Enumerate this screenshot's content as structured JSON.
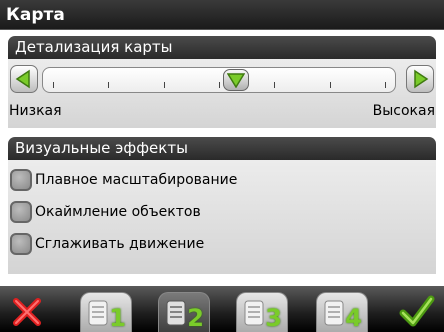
{
  "window": {
    "title": "Карта"
  },
  "detail": {
    "header": "Детализация карты",
    "low_label": "Низкая",
    "high_label": "Высокая",
    "level": 0.55,
    "tick_count": 7
  },
  "effects": {
    "header": "Визуальные эффекты",
    "items": [
      {
        "label": "Плавное масштабирование",
        "checked": false
      },
      {
        "label": "Окаймление объектов",
        "checked": false
      },
      {
        "label": "Сглаживать движение",
        "checked": false
      }
    ]
  },
  "bottom": {
    "profiles": [
      "1",
      "2",
      "3",
      "4"
    ],
    "active_profile": "2",
    "cancel_icon": "red-x-icon",
    "ok_icon": "green-check-icon"
  },
  "colors": {
    "accent_green": "#7acb2a",
    "cancel_red": "#e02020",
    "header_dark": "#2a2a2a"
  }
}
